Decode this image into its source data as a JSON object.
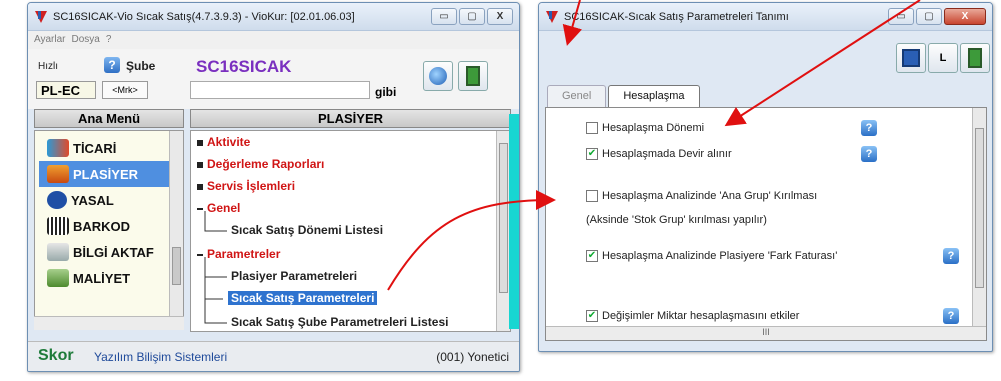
{
  "left_window": {
    "title": "SC16SICAK-Vio Sıcak Satış(4.7.3.9.3) - VioKur: [02.01.06.03]",
    "caption": {
      "min": "▭",
      "max": "▢",
      "close": "X"
    },
    "menu": [
      "Ayarlar",
      "Dosya",
      "?"
    ],
    "hizli_label": "Hızlı",
    "sube_label": "Şube",
    "code_value": "PL-EC",
    "mrk_value": "<Mrk>",
    "app_code": "SC16SICAK",
    "gibi_label": "gibi",
    "ana_menu_header": "Ana Menü",
    "menu_items": [
      {
        "label": "TİCARİ",
        "icon": "trade-icon",
        "selected": false
      },
      {
        "label": "PLASİYER",
        "icon": "truck-icon",
        "selected": true
      },
      {
        "label": "YASAL",
        "icon": "mb-icon",
        "selected": false
      },
      {
        "label": "BARKOD",
        "icon": "barcode-icon",
        "selected": false
      },
      {
        "label": "BİLGİ AKTAF",
        "icon": "printer-icon",
        "selected": false
      },
      {
        "label": "MALİYET",
        "icon": "money-icon",
        "selected": false
      }
    ],
    "plasiyer_header": "PLASİYER",
    "tree": {
      "aktivite": "Aktivite",
      "degerleme": "Değerleme Raporları",
      "servis": "Servis İşlemleri",
      "genel": "Genel",
      "sicak_satis_donemi": "Sıcak Satış Dönemi Listesi",
      "parametreler": "Parametreler",
      "plasiyer_param": "Plasiyer Parametreleri",
      "sicak_satis_param": "Sıcak Satış Parametreleri",
      "sube_param": "Sıcak Satış Şube Parametreleri Listesi"
    },
    "status": {
      "brand": "Skor",
      "company": "Yazılım Bilişim Sistemleri",
      "user": "(001) Yonetici"
    }
  },
  "right_window": {
    "title": "SC16SICAK-Sıcak Satış Parametreleri Tanımı",
    "caption": {
      "min": "▭",
      "max": "▢",
      "close": "X"
    },
    "toolbar": {
      "save": "💾",
      "l_label": "L",
      "exit": "⇥"
    },
    "tabs": [
      {
        "label": "Genel",
        "active": false
      },
      {
        "label": "Hesaplaşma",
        "active": true
      }
    ],
    "options": [
      {
        "label": "Hesaplaşma Dönemi",
        "checked": false
      },
      {
        "label": "Hesaplaşmada Devir alınır",
        "checked": true
      },
      {
        "label": "Hesaplaşma Analizinde 'Ana Grup' Kırılması",
        "checked": false
      },
      {
        "label": "Hesaplaşma Analizinde Plasiyere 'Fark Faturası'",
        "checked": true
      },
      {
        "label": "Değişimler Miktar hesaplaşmasını etkiler",
        "checked": true
      }
    ],
    "note": "(Aksinde 'Stok Grup' kırılması yapılır)",
    "help_glyph": "?",
    "scroll_glyph": "III"
  },
  "colors": {
    "arrow": "#e01010",
    "accent": "#7a2fbf",
    "cyan": "#18d6d2",
    "selection": "#2e73cf"
  }
}
